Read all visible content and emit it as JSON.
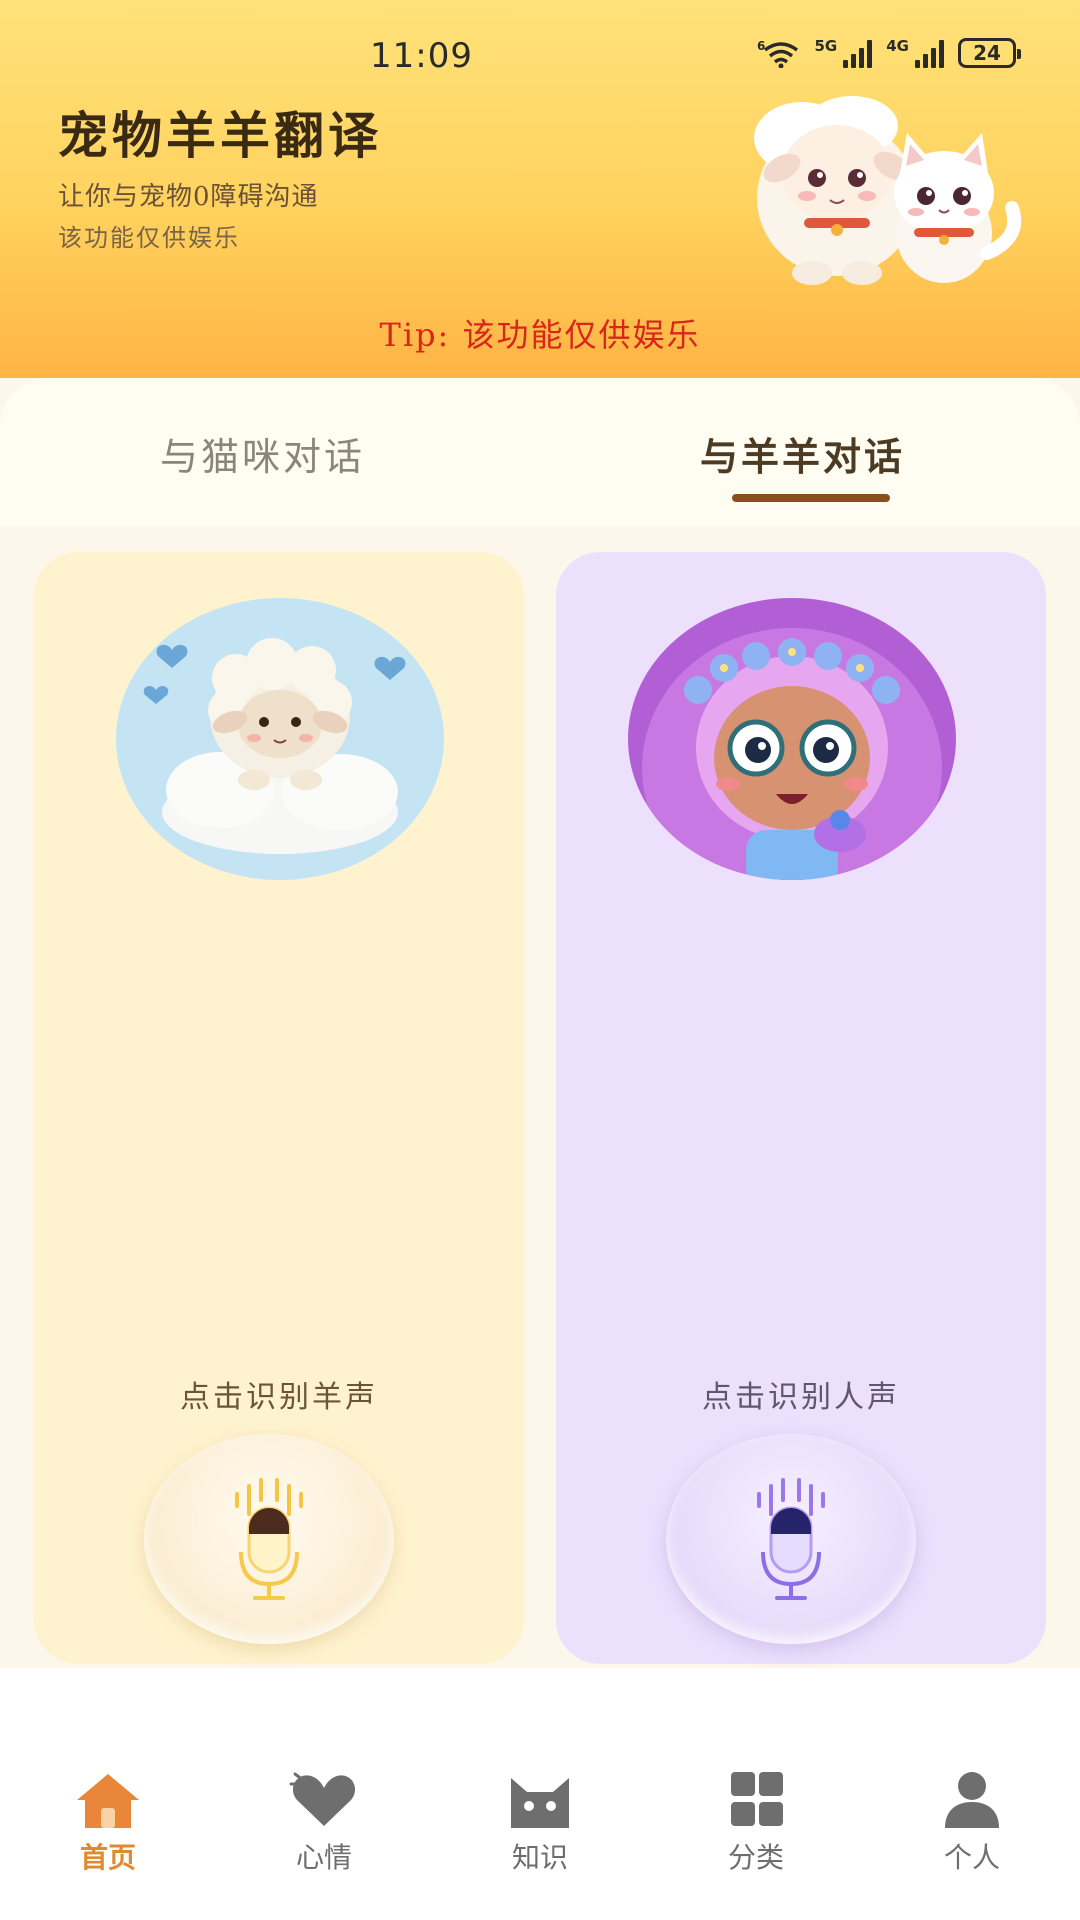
{
  "status_bar": {
    "time": "11:09",
    "signal_1": "5G",
    "signal_2": "4G",
    "wifi_badge": "6",
    "battery": "24"
  },
  "header": {
    "title": "宠物羊羊翻译",
    "subtitle": "让你与宠物0障碍沟通",
    "subtitle2": "该功能仅供娱乐",
    "tip": "Tip: 该功能仅供娱乐"
  },
  "tabs": [
    {
      "label": "与猫咪对话",
      "active": false
    },
    {
      "label": "与羊羊对话",
      "active": true
    }
  ],
  "cards": [
    {
      "avatar": "sheep-on-cloud",
      "label": "点击识别羊声",
      "accent": "#fff3cf"
    },
    {
      "avatar": "cartoon-girl",
      "label": "点击识别人声",
      "accent": "#ede0fd"
    }
  ],
  "bottom_nav": [
    {
      "label": "首页",
      "icon": "home-icon",
      "active": true
    },
    {
      "label": "心情",
      "icon": "heart-icon",
      "active": false
    },
    {
      "label": "知识",
      "icon": "cat-icon",
      "active": false
    },
    {
      "label": "分类",
      "icon": "grid-icon",
      "active": false
    },
    {
      "label": "个人",
      "icon": "person-icon",
      "active": false
    }
  ],
  "colors": {
    "active_nav": "#e08a2e",
    "tip": "#d8261a",
    "tab_underline": "#8a4f1e"
  }
}
